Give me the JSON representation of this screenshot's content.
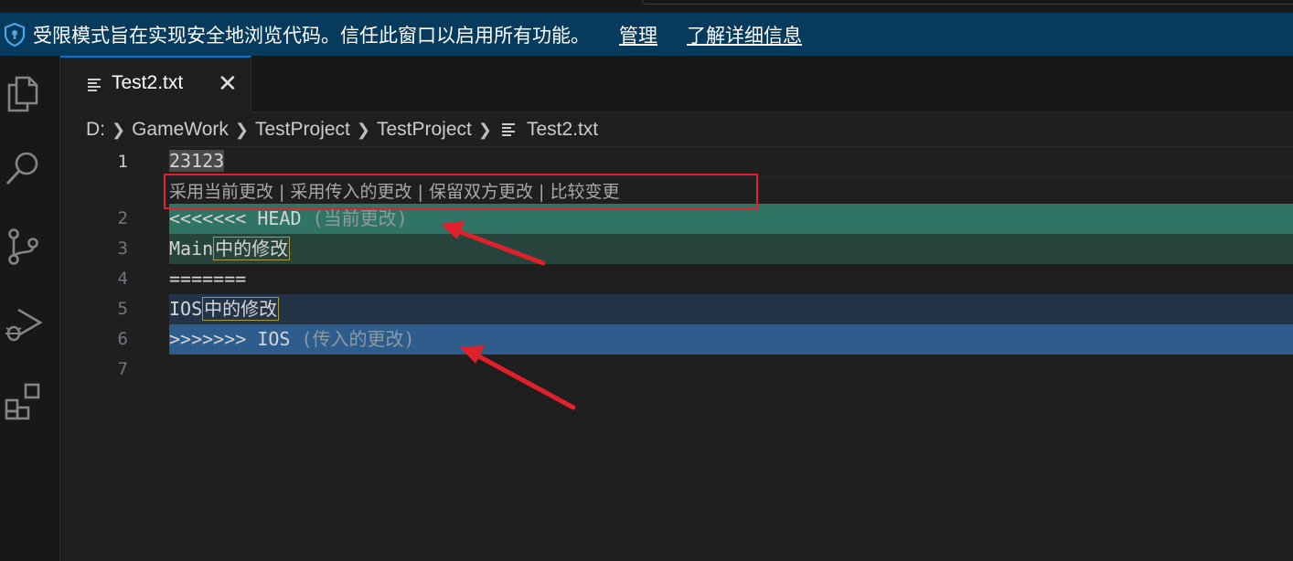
{
  "banner": {
    "message": "受限模式旨在实现安全地浏览代码。信任此窗口以启用所有功能。",
    "manage_link": "管理",
    "learn_more_link": "了解详细信息"
  },
  "activity_bar": {
    "items": [
      "explorer-icon",
      "search-icon",
      "source-control-icon",
      "run-debug-icon",
      "extensions-icon"
    ]
  },
  "tab": {
    "label": "Test2.txt",
    "close": "✕"
  },
  "breadcrumb": {
    "segments": [
      "D:",
      "GameWork",
      "TestProject",
      "TestProject",
      "Test2.txt"
    ]
  },
  "codelens": {
    "accept_current": "采用当前更改",
    "accept_incoming": "采用传入的更改",
    "accept_both": "保留双方更改",
    "compare": "比较变更",
    "separator": " | "
  },
  "editor": {
    "line_numbers": [
      "1",
      "2",
      "3",
      "4",
      "5",
      "6",
      "7"
    ],
    "line1": "23123",
    "line2_marker": "<<<<<<< HEAD",
    "line2_hint": " (当前更改)",
    "line3_prefix": "Main",
    "line3_cjk": "中的修改",
    "line4": "=======",
    "line5_prefix": "IOS",
    "line5_cjk": "中的修改",
    "line6_marker": ">>>>>>> IOS",
    "line6_hint": " (传入的更改)"
  },
  "colors": {
    "banner_bg": "#063b5e",
    "current_header": "#2f7464",
    "current_body": "#27443d",
    "incoming_body": "#243448",
    "incoming_header": "#2e5c8c",
    "annotation_red": "#e0202a"
  }
}
